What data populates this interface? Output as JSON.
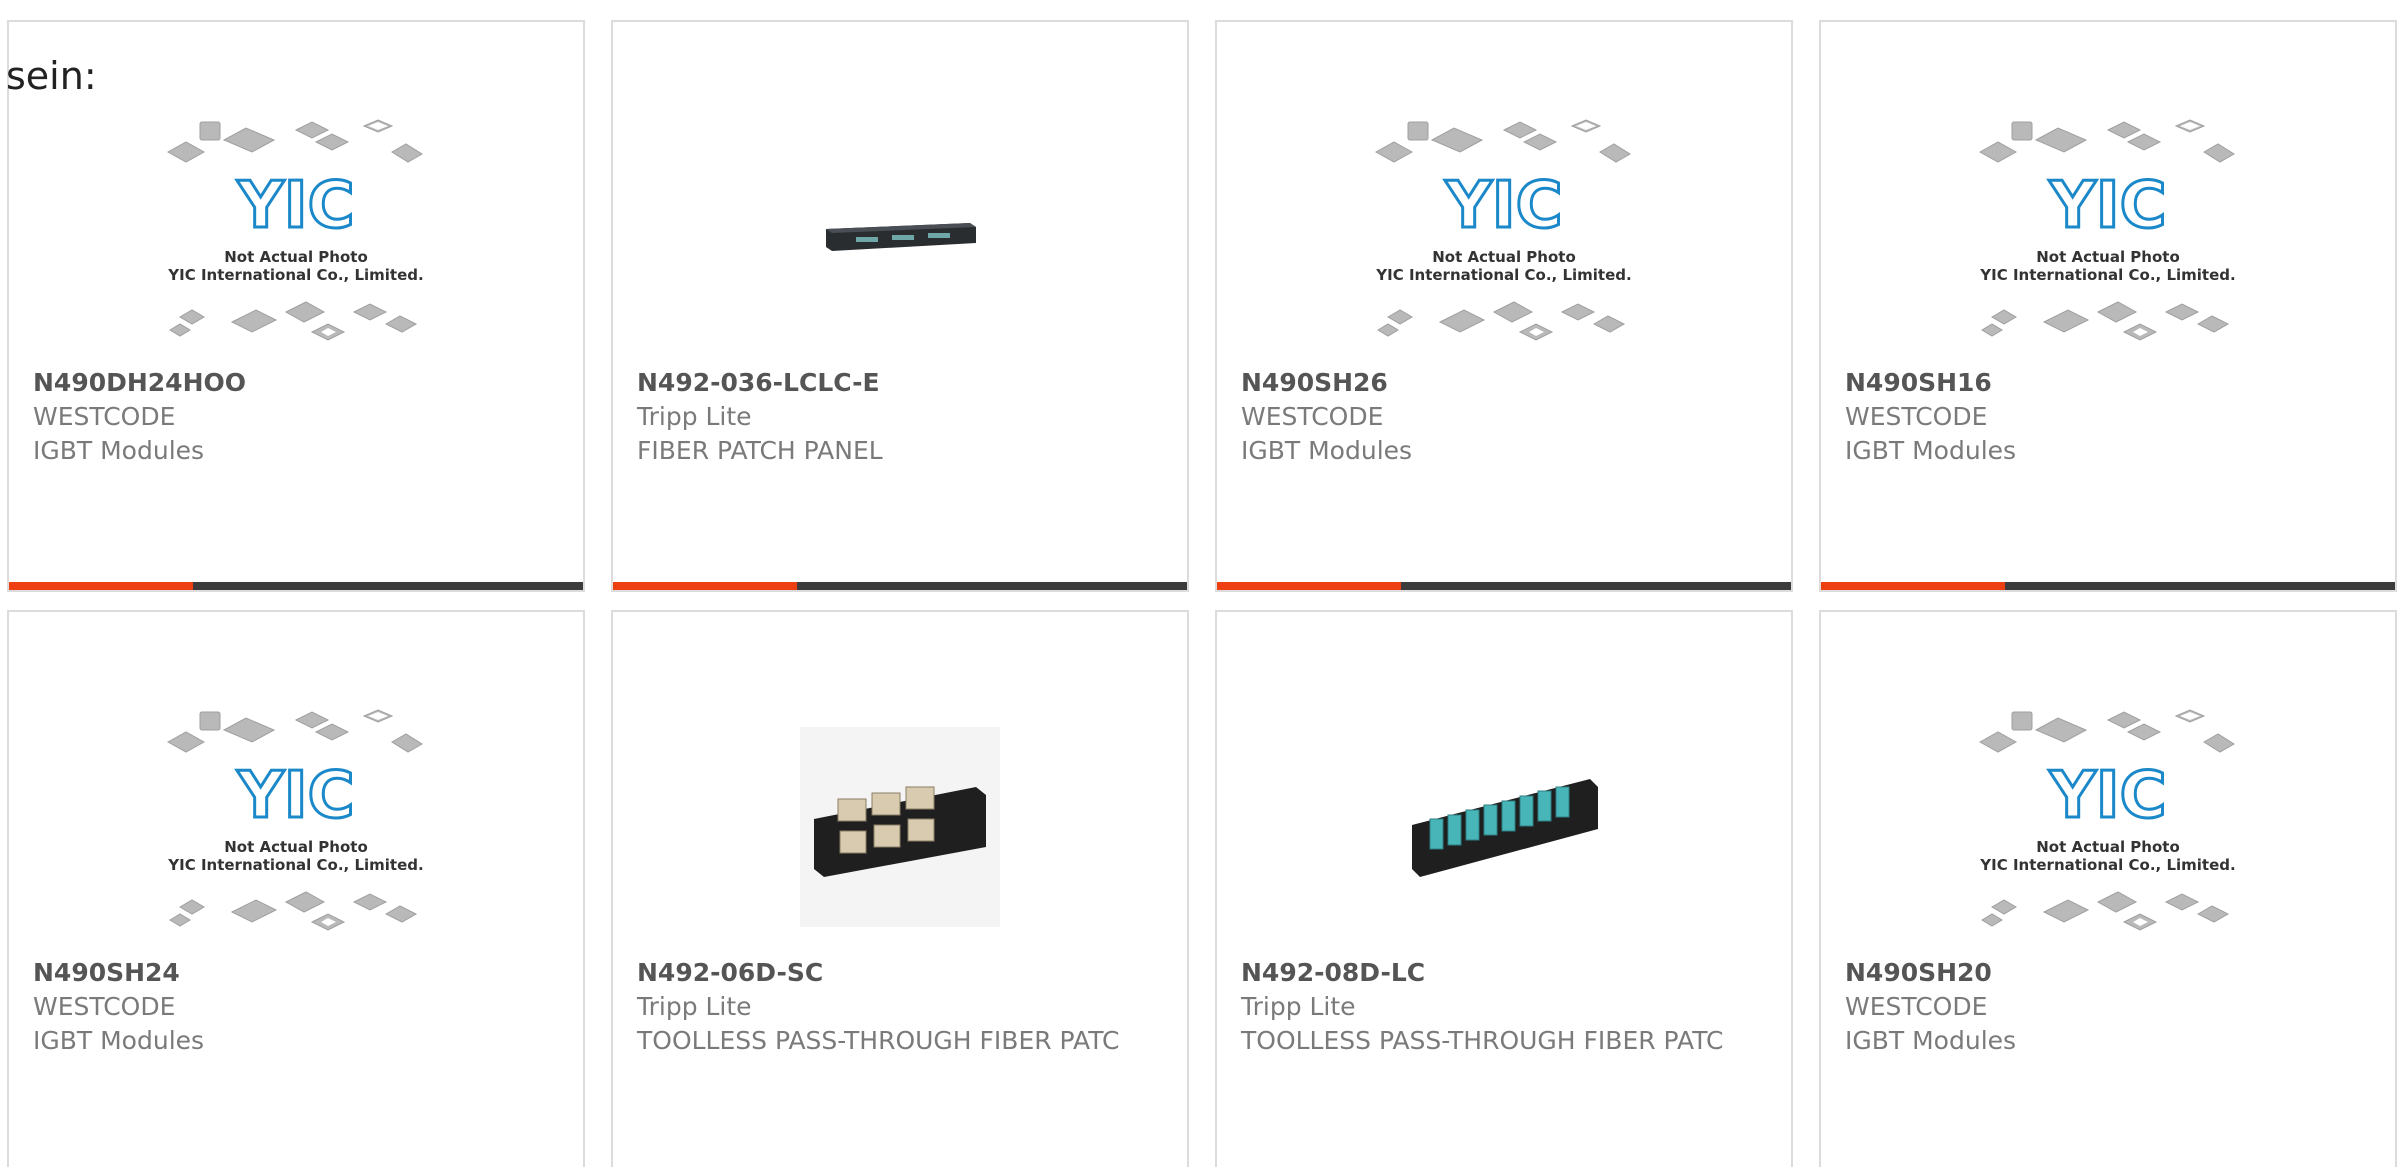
{
  "intro": "sein:",
  "products": [
    {
      "part": "N490DH24HOO",
      "brand": "WESTCODE",
      "description": "IGBT Modules",
      "image": "yic-placeholder"
    },
    {
      "part": "N492-036-LCLC-E",
      "brand": "Tripp Lite",
      "description": "FIBER PATCH PANEL",
      "image": "rack-patch-panel"
    },
    {
      "part": "N490SH26",
      "brand": "WESTCODE",
      "description": "IGBT Modules",
      "image": "yic-placeholder"
    },
    {
      "part": "N490SH16",
      "brand": "WESTCODE",
      "description": "IGBT Modules",
      "image": "yic-placeholder"
    },
    {
      "part": "N490SH24",
      "brand": "WESTCODE",
      "description": "IGBT Modules",
      "image": "yic-placeholder"
    },
    {
      "part": "N492-06D-SC",
      "brand": "Tripp Lite",
      "description": "TOOLLESS PASS-THROUGH FIBER PATC",
      "image": "sc-fiber-panel"
    },
    {
      "part": "N492-08D-LC",
      "brand": "Tripp Lite",
      "description": "TOOLLESS PASS-THROUGH FIBER PATC",
      "image": "lc-fiber-panel"
    },
    {
      "part": "N490SH20",
      "brand": "WESTCODE",
      "description": "IGBT Modules",
      "image": "yic-placeholder"
    }
  ],
  "placeholder": {
    "line1": "Not Actual Photo",
    "line2": "YIC International Co., Limited.",
    "logo": "YIC"
  },
  "colors": {
    "accent": "#ee3f12",
    "bar": "#3c3c3c",
    "logo": "#1a88c9",
    "text": "#7a7a7a"
  }
}
